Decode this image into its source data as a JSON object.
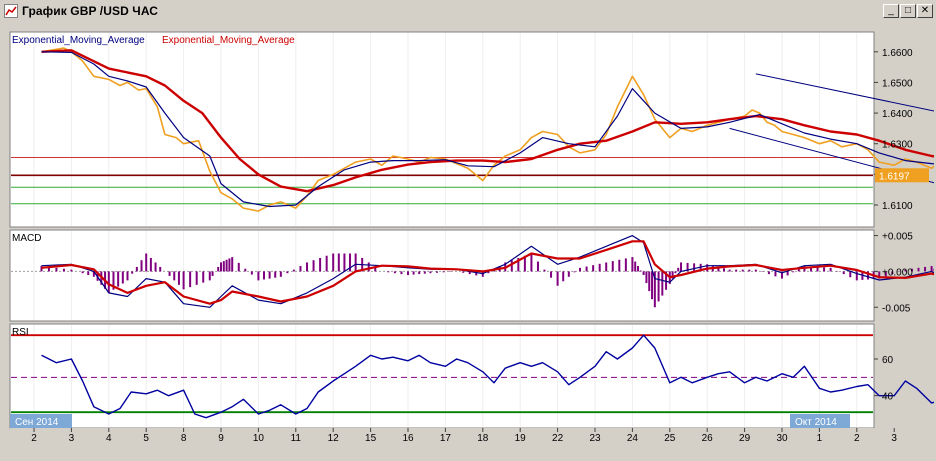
{
  "window": {
    "title": "График GBP /USD  ЧАС",
    "minimize_label": "_",
    "maximize_label": "□",
    "close_label": "✕",
    "colors": {
      "chrome": "#d4d0c8",
      "chart_bg": "#ffffff"
    }
  },
  "chart_data": [
    {
      "type": "line",
      "panel": "price",
      "legend": [
        {
          "text": "Exponential_Moving_Average",
          "color": "#000080"
        },
        {
          "text": "Exponential_Moving_Average",
          "color": "#cc0000"
        }
      ],
      "y_ticks": [
        "1.6600",
        "1.6500",
        "1.6400",
        "1.6300",
        "1.6200",
        "1.6100"
      ],
      "ylim": [
        1.6038,
        1.6645
      ],
      "current_price_label": "1.6197",
      "current_price": 1.6197,
      "horizontal_levels": [
        {
          "value": 1.6255,
          "color": "#cc3333"
        },
        {
          "value": 1.6197,
          "color": "#800000"
        },
        {
          "value": 1.6158,
          "color": "#33aa33"
        },
        {
          "value": 1.6104,
          "color": "#33aa33"
        }
      ],
      "trend_channel": {
        "upper": [
          [
            19.3,
            1.6528
          ],
          [
            32.0,
            1.6205
          ]
        ],
        "lower": [
          [
            18.6,
            1.635
          ],
          [
            28.0,
            1.6045
          ]
        ],
        "color": "#000080"
      },
      "series": [
        {
          "name": "price",
          "color": "#f0a020",
          "x": [
            0.2,
            0.8,
            1.0,
            1.3,
            1.6,
            2.0,
            2.3,
            2.5,
            2.8,
            3.0,
            3.3,
            3.5,
            3.8,
            4.0,
            4.4,
            4.7,
            5.0,
            5.3,
            5.6,
            6.0,
            6.3,
            6.6,
            7.0,
            7.3,
            7.6,
            8.0,
            8.3,
            8.6,
            9.0,
            9.3,
            9.6,
            10.0,
            10.3,
            10.6,
            11.0,
            11.3,
            11.6,
            12.0,
            12.3,
            12.6,
            13.0,
            13.3,
            13.6,
            14.0,
            14.3,
            14.6,
            15.0,
            15.3,
            15.6,
            16.0,
            16.3,
            16.6,
            17.0,
            17.3,
            17.6,
            18.0,
            18.3,
            18.6,
            19.0,
            19.2,
            19.4,
            19.6,
            19.8,
            20.0,
            20.3,
            20.6,
            21.0,
            21.3,
            21.6,
            22.0,
            22.3,
            22.6,
            23.0,
            23.3,
            23.6,
            24.0,
            24.3,
            24.6,
            25.0,
            25.3,
            25.6,
            26.0,
            26.3,
            26.6,
            27.0,
            27.3,
            27.6,
            28.0,
            28.3,
            28.5,
            28.7,
            28.9
          ],
          "values": [
            1.66,
            1.6612,
            1.66,
            1.657,
            1.652,
            1.651,
            1.649,
            1.65,
            1.6475,
            1.648,
            1.642,
            1.633,
            1.632,
            1.63,
            1.631,
            1.621,
            1.614,
            1.612,
            1.609,
            1.608,
            1.61,
            1.611,
            1.609,
            1.613,
            1.618,
            1.62,
            1.622,
            1.624,
            1.625,
            1.623,
            1.626,
            1.625,
            1.624,
            1.6255,
            1.625,
            1.6235,
            1.622,
            1.618,
            1.623,
            1.626,
            1.628,
            1.632,
            1.634,
            1.633,
            1.629,
            1.627,
            1.628,
            1.633,
            1.642,
            1.652,
            1.646,
            1.638,
            1.632,
            1.635,
            1.634,
            1.636,
            1.637,
            1.638,
            1.639,
            1.641,
            1.64,
            1.637,
            1.636,
            1.634,
            1.633,
            1.632,
            1.63,
            1.631,
            1.629,
            1.63,
            1.628,
            1.624,
            1.623,
            1.625,
            1.624,
            1.622,
            1.625,
            1.623,
            1.621,
            1.62,
            1.6205,
            1.6197,
            1.6197,
            1.6197,
            1.6197,
            1.6197,
            1.6197,
            1.6197,
            1.6197,
            1.6197,
            1.6197,
            1.6197
          ]
        },
        {
          "name": "ema_fast",
          "color": "#000080",
          "x": [
            0.2,
            1.0,
            1.6,
            2.0,
            2.5,
            3.0,
            3.5,
            4.0,
            4.7,
            5.0,
            5.6,
            6.3,
            7.0,
            7.6,
            8.3,
            9.0,
            9.6,
            10.3,
            11.0,
            11.6,
            12.3,
            13.0,
            13.6,
            14.3,
            15.0,
            15.6,
            16.0,
            16.6,
            17.3,
            18.0,
            18.6,
            19.4,
            20.0,
            20.6,
            21.3,
            22.0,
            22.6,
            23.3,
            24.0,
            24.6,
            25.3,
            26.0,
            26.6
          ],
          "values": [
            1.66,
            1.6598,
            1.656,
            1.652,
            1.6505,
            1.6485,
            1.64,
            1.632,
            1.626,
            1.617,
            1.611,
            1.6095,
            1.61,
            1.616,
            1.6215,
            1.624,
            1.6245,
            1.6245,
            1.6248,
            1.6228,
            1.6225,
            1.627,
            1.632,
            1.63,
            1.629,
            1.639,
            1.648,
            1.64,
            1.635,
            1.6355,
            1.637,
            1.6395,
            1.6365,
            1.6335,
            1.6315,
            1.63,
            1.627,
            1.6245,
            1.6235,
            1.623,
            1.6215,
            1.6203,
            1.62
          ]
        },
        {
          "name": "ema_slow",
          "color": "#cc0000",
          "x": [
            0.2,
            1.0,
            2.0,
            3.0,
            3.5,
            4.0,
            4.5,
            5.0,
            5.5,
            6.0,
            6.6,
            7.3,
            8.0,
            8.6,
            9.3,
            10.0,
            10.6,
            11.3,
            12.0,
            12.6,
            13.3,
            14.0,
            14.6,
            15.3,
            16.0,
            16.6,
            17.3,
            18.0,
            18.6,
            19.3,
            20.0,
            20.6,
            21.3,
            22.0,
            22.6,
            23.3,
            24.0,
            24.6,
            25.3,
            26.0,
            26.6
          ],
          "values": [
            1.66,
            1.6605,
            1.6545,
            1.652,
            1.649,
            1.644,
            1.64,
            1.632,
            1.625,
            1.62,
            1.616,
            1.6145,
            1.6165,
            1.619,
            1.6215,
            1.6232,
            1.624,
            1.6245,
            1.6245,
            1.624,
            1.625,
            1.628,
            1.63,
            1.631,
            1.634,
            1.637,
            1.6365,
            1.637,
            1.638,
            1.639,
            1.638,
            1.636,
            1.634,
            1.633,
            1.631,
            1.628,
            1.626,
            1.625,
            1.6245,
            1.6235,
            1.623
          ]
        }
      ]
    },
    {
      "type": "line",
      "panel": "macd",
      "title": "MACD",
      "y_ticks": [
        "+0.005",
        "+0.000",
        "-0.005"
      ],
      "ylim": [
        -0.0065,
        0.0055
      ],
      "series": [
        {
          "name": "macd",
          "color": "#000080",
          "x": [
            0.2,
            1.0,
            1.6,
            2.0,
            2.5,
            3.0,
            3.5,
            4.0,
            4.7,
            5.0,
            5.3,
            6.0,
            6.6,
            7.3,
            8.0,
            8.6,
            9.3,
            10.0,
            10.6,
            11.3,
            12.0,
            12.6,
            13.3,
            14.0,
            14.6,
            15.3,
            16.0,
            16.3,
            16.6,
            17.0,
            17.3,
            18.0,
            18.6,
            19.3,
            20.0,
            20.6,
            21.3,
            22.0,
            22.6,
            23.3,
            24.0,
            24.3,
            24.6,
            25.0,
            25.3,
            25.6,
            26.0,
            26.3
          ],
          "values": [
            0.0008,
            0.001,
            0.0,
            -0.003,
            -0.0035,
            -0.001,
            -0.0015,
            -0.0045,
            -0.005,
            -0.0035,
            -0.002,
            -0.004,
            -0.0045,
            -0.003,
            -0.001,
            0.001,
            0.0008,
            0.0005,
            0.0003,
            0.0003,
            -0.0003,
            0.001,
            0.0035,
            0.001,
            0.002,
            0.0035,
            0.005,
            0.004,
            -0.001,
            -0.0015,
            0.0,
            0.0008,
            0.0008,
            0.001,
            -0.0002,
            0.0008,
            0.001,
            -0.0003,
            -0.0012,
            -0.0008,
            0.0,
            -0.001,
            -0.002,
            -0.0018,
            -0.0005,
            0.0005,
            -0.0002,
            0.0
          ]
        },
        {
          "name": "signal",
          "color": "#cc0000",
          "x": [
            0.2,
            1.0,
            1.6,
            2.0,
            2.5,
            3.0,
            3.5,
            4.0,
            4.7,
            5.0,
            5.3,
            6.0,
            6.6,
            7.3,
            8.0,
            8.6,
            9.3,
            10.0,
            10.6,
            11.3,
            12.0,
            12.6,
            13.3,
            14.0,
            14.6,
            15.3,
            16.0,
            16.3,
            16.6,
            17.0,
            17.3,
            18.0,
            18.6,
            19.3,
            20.0,
            20.6,
            21.3,
            22.0,
            22.6,
            23.3,
            24.0,
            24.3,
            24.6,
            25.0,
            25.3,
            25.6,
            26.0,
            26.3
          ],
          "values": [
            0.0005,
            0.0009,
            0.0003,
            -0.0018,
            -0.003,
            -0.002,
            -0.0015,
            -0.0035,
            -0.0045,
            -0.004,
            -0.0028,
            -0.0035,
            -0.0042,
            -0.0035,
            -0.002,
            0.0,
            0.0008,
            0.0007,
            0.0004,
            0.0003,
            0.0,
            0.0005,
            0.0025,
            0.0018,
            0.0018,
            0.003,
            0.0042,
            0.0042,
            0.001,
            -0.0008,
            -0.0005,
            0.0004,
            0.0007,
            0.0009,
            0.0002,
            0.0005,
            0.0008,
            0.0002,
            -0.0008,
            -0.0009,
            -0.0003,
            -0.0007,
            -0.0015,
            -0.0017,
            -0.0008,
            0.0002,
            -0.0001,
            -0.001
          ]
        }
      ]
    },
    {
      "type": "line",
      "panel": "rsi",
      "title": "RSI",
      "y_ticks": [
        "60",
        "40"
      ],
      "ylim": [
        24,
        78
      ],
      "levels": [
        {
          "value": 73,
          "color": "#cc0000"
        },
        {
          "value": 50,
          "color": "#800080"
        },
        {
          "value": 31,
          "color": "#008000"
        }
      ],
      "series": [
        {
          "name": "rsi",
          "color": "#0000a0",
          "x": [
            0.2,
            0.6,
            1.0,
            1.3,
            1.6,
            2.0,
            2.3,
            2.6,
            3.0,
            3.3,
            3.6,
            4.0,
            4.3,
            4.6,
            5.0,
            5.3,
            5.6,
            6.0,
            6.3,
            6.6,
            7.0,
            7.3,
            7.6,
            8.0,
            8.3,
            8.6,
            9.0,
            9.3,
            9.6,
            10.0,
            10.3,
            10.6,
            11.0,
            11.3,
            11.6,
            12.0,
            12.3,
            12.6,
            13.0,
            13.3,
            13.6,
            14.0,
            14.3,
            14.6,
            15.0,
            15.3,
            15.6,
            16.0,
            16.3,
            16.6,
            17.0,
            17.3,
            17.6,
            18.0,
            18.3,
            18.6,
            19.0,
            19.3,
            19.6,
            20.0,
            20.3,
            20.6,
            21.0,
            21.3,
            21.6,
            22.0,
            22.3,
            22.6,
            23.0,
            23.3,
            23.6,
            24.0,
            24.3,
            24.6,
            25.0,
            25.3,
            25.6,
            26.0,
            26.3
          ],
          "values": [
            62,
            58,
            60,
            48,
            34,
            30,
            33,
            42,
            41,
            43,
            40,
            43,
            30,
            28,
            31,
            34,
            38,
            30,
            32,
            35,
            30,
            33,
            42,
            48,
            52,
            56,
            62,
            60,
            61,
            59,
            62,
            58,
            56,
            60,
            58,
            53,
            47,
            55,
            58,
            56,
            58,
            53,
            46,
            50,
            56,
            64,
            60,
            66,
            73,
            66,
            47,
            50,
            47,
            50,
            52,
            53,
            47,
            50,
            48,
            52,
            50,
            56,
            44,
            42,
            43,
            45,
            46,
            40,
            40,
            48,
            44,
            36,
            38,
            44,
            38,
            42,
            48,
            40,
            42
          ]
        }
      ]
    }
  ],
  "x_axis": {
    "date_labels": [
      "Сен 2014",
      "Окт 2014"
    ],
    "ticks": [
      {
        "x": 0,
        "label": "2"
      },
      {
        "x": 1,
        "label": "3"
      },
      {
        "x": 2,
        "label": "4"
      },
      {
        "x": 3,
        "label": "5"
      },
      {
        "x": 4,
        "label": "8"
      },
      {
        "x": 5,
        "label": "9"
      },
      {
        "x": 6,
        "label": "10"
      },
      {
        "x": 7,
        "label": "11"
      },
      {
        "x": 8,
        "label": "12"
      },
      {
        "x": 9,
        "label": "15"
      },
      {
        "x": 10,
        "label": "16"
      },
      {
        "x": 11,
        "label": "17"
      },
      {
        "x": 12,
        "label": "18"
      },
      {
        "x": 13,
        "label": "19"
      },
      {
        "x": 14,
        "label": "22"
      },
      {
        "x": 15,
        "label": "23"
      },
      {
        "x": 16,
        "label": "24"
      },
      {
        "x": 17,
        "label": "25"
      },
      {
        "x": 18,
        "label": "26"
      },
      {
        "x": 19,
        "label": "29"
      },
      {
        "x": 20,
        "label": "30"
      },
      {
        "x": 21,
        "label": "1"
      },
      {
        "x": 22,
        "label": "2"
      },
      {
        "x": 23,
        "label": "3"
      }
    ]
  }
}
